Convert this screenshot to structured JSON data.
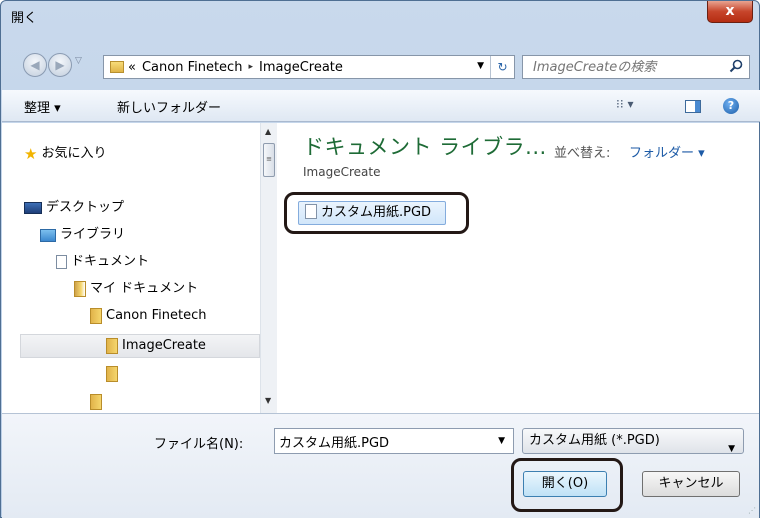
{
  "window": {
    "title": "開く",
    "close_label": "x"
  },
  "address": {
    "breadcrumb_prefix": "«",
    "crumbs": [
      "Canon Finetech",
      "ImageCreate"
    ],
    "separator": "▸"
  },
  "search": {
    "placeholder": "ImageCreateの検索"
  },
  "toolbar": {
    "organize": "整理 ▾",
    "new_folder": "新しいフォルダー",
    "view_icon_glyph": "⁝⁝ ▾",
    "help_glyph": "?"
  },
  "nav": {
    "favorites": "お気に入り",
    "desktop": "デスクトップ",
    "libraries": "ライブラリ",
    "documents": "ドキュメント",
    "my_documents": "マイ ドキュメント",
    "canon": "Canon Finetech",
    "imagecreate": "ImageCreate"
  },
  "main": {
    "title": "ドキュメント ライブラ...",
    "subtitle": "ImageCreate",
    "sort_label": "並べ替え:",
    "sort_value": "フォルダー ▾",
    "files": [
      {
        "name": "カスタム用紙.PGD"
      }
    ]
  },
  "footer": {
    "filename_label": "ファイル名(N):",
    "filename_value": "カスタム用紙.PGD",
    "filetype_value": "カスタム用紙 (*.PGD)",
    "open_button": "開く(O)",
    "cancel_button": "キャンセル"
  },
  "colors": {
    "title_green": "#1e6b36",
    "link_blue": "#1c5aa6",
    "highlight_ring": "#231815"
  }
}
